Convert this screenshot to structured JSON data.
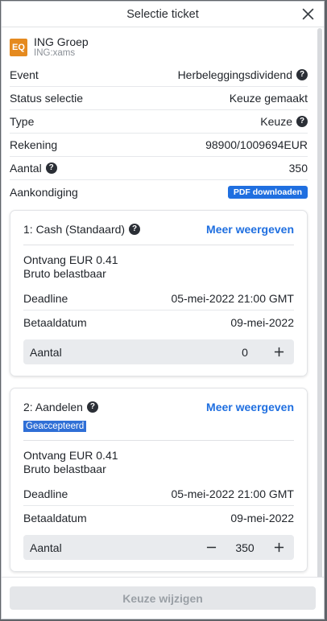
{
  "window": {
    "title": "Selectie ticket"
  },
  "instrument": {
    "badge": "EQ",
    "name": "ING Groep",
    "ticker": "ING:xams"
  },
  "details": [
    {
      "label": "Event",
      "value": "Herbeleggingsdividend",
      "value_help": true
    },
    {
      "label": "Status selectie",
      "value": "Keuze gemaakt"
    },
    {
      "label": "Type",
      "value": "Keuze",
      "value_help": true
    },
    {
      "label": "Rekening",
      "value": "98900/1009694EUR"
    },
    {
      "label": "Aantal",
      "value": "350",
      "label_help": true
    },
    {
      "label": "Aankondiging",
      "button": "PDF downloaden"
    }
  ],
  "options": [
    {
      "title": "1: Cash (Standaard)",
      "more": "Meer weergeven",
      "info1": "Ontvang EUR 0.41",
      "info2": "Bruto belastbaar",
      "deadline_label": "Deadline",
      "deadline": "05-mei-2022 21:00 GMT",
      "paydate_label": "Betaaldatum",
      "paydate": "09-mei-2022",
      "qty_label": "Aantal",
      "qty": "0"
    },
    {
      "title": "2: Aandelen",
      "more": "Meer weergeven",
      "status": "Geaccepteerd",
      "info1": "Ontvang EUR 0.41",
      "info2": "Bruto belastbaar",
      "deadline_label": "Deadline",
      "deadline": "05-mei-2022 21:00 GMT",
      "paydate_label": "Betaaldatum",
      "paydate": "09-mei-2022",
      "qty_label": "Aantal",
      "qty": "350"
    }
  ],
  "footer": {
    "button": "Keuze wijzigen"
  },
  "colors": {
    "accent": "#1f6fe0",
    "badge": "#e58a1f",
    "status_highlight": "#2f6fd6"
  },
  "icons": {
    "close": "close-icon",
    "help": "help-icon",
    "plus": "plus-icon",
    "minus": "minus-icon"
  }
}
